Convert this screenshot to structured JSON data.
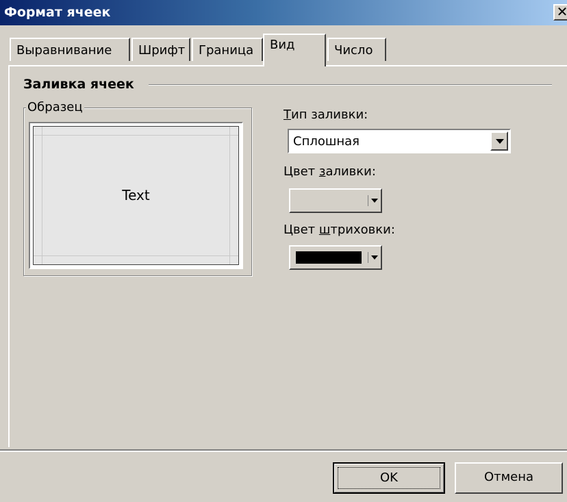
{
  "window": {
    "title": "Формат ячеек"
  },
  "tabs": [
    {
      "label": "Выравнивание"
    },
    {
      "label": "Шрифт"
    },
    {
      "label": "Граница"
    },
    {
      "label": "Вид",
      "active": true
    },
    {
      "label": "Число"
    }
  ],
  "fill_group": {
    "title": "Заливка ячеек",
    "sample_label": "Образец",
    "sample_text": "Text"
  },
  "fill_type": {
    "label_accel": "Т",
    "label_rest": "ип заливки:",
    "value": "Сплошная"
  },
  "fill_color": {
    "label_pre": "Цвет ",
    "label_accel": "з",
    "label_rest": "аливки:",
    "color": "#d4d0c8"
  },
  "hatch_color": {
    "label_pre": "Цвет ",
    "label_accel": "ш",
    "label_rest": "триховки:",
    "color": "#000000"
  },
  "buttons": {
    "ok": "OK",
    "cancel": "Отмена"
  }
}
